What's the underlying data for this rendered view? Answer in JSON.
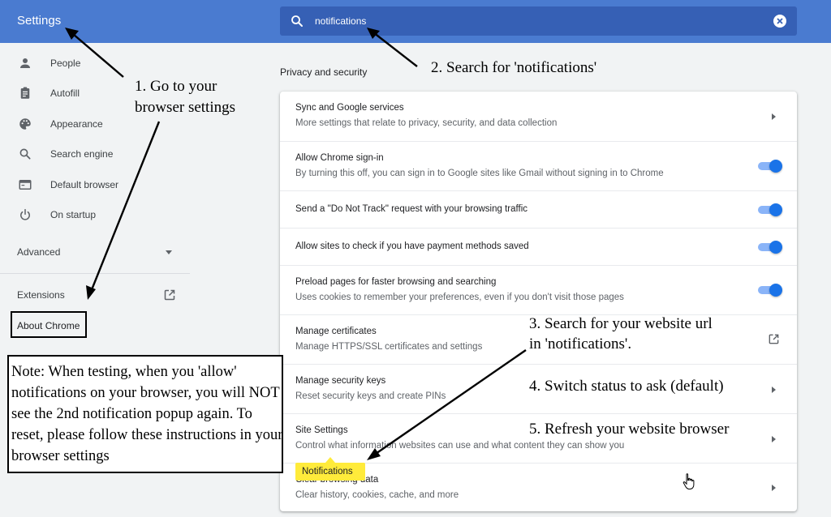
{
  "header": {
    "title": "Settings",
    "search_value": "notifications"
  },
  "sidebar": {
    "items": [
      {
        "label": "People",
        "icon": "person-icon"
      },
      {
        "label": "Autofill",
        "icon": "clipboard-icon"
      },
      {
        "label": "Appearance",
        "icon": "palette-icon"
      },
      {
        "label": "Search engine",
        "icon": "search-icon"
      },
      {
        "label": "Default browser",
        "icon": "browser-window-icon"
      },
      {
        "label": "On startup",
        "icon": "power-icon"
      }
    ],
    "advanced": "Advanced",
    "extensions": "Extensions",
    "about": "About Chrome"
  },
  "main": {
    "section_title": "Privacy and security",
    "rows": [
      {
        "title": "Sync and Google services",
        "subtitle": "More settings that relate to privacy, security, and data collection",
        "control": "arrow"
      },
      {
        "title": "Allow Chrome sign-in",
        "subtitle": "By turning this off, you can sign in to Google sites like Gmail without signing in to Chrome",
        "control": "toggle",
        "on": true
      },
      {
        "title": "Send a \"Do Not Track\" request with your browsing traffic",
        "subtitle": "",
        "control": "toggle",
        "on": true
      },
      {
        "title": "Allow sites to check if you have payment methods saved",
        "subtitle": "",
        "control": "toggle",
        "on": true
      },
      {
        "title": "Preload pages for faster browsing and searching",
        "subtitle": "Uses cookies to remember your preferences, even if you don't visit those pages",
        "control": "toggle",
        "on": true
      },
      {
        "title": "Manage certificates",
        "subtitle": "Manage HTTPS/SSL certificates and settings",
        "control": "external"
      },
      {
        "title": "Manage security keys",
        "subtitle": "Reset security keys and create PINs",
        "control": "arrow"
      },
      {
        "title": "Site Settings",
        "subtitle": "Control what information websites can use and what content they can show you",
        "control": "arrow"
      },
      {
        "title": "Clear browsing data",
        "subtitle": "Clear history, cookies, cache, and more",
        "control": "arrow"
      }
    ],
    "highlight_label": "Notifications"
  },
  "annotations": {
    "step1_line1": "1. Go to your",
    "step1_line2": "browser settings",
    "step2": "2. Search for 'notifications'",
    "step3_line1": "3. Search for your website url",
    "step3_line2": "in 'notifications'.",
    "step4": "4. Switch status to ask (default)",
    "step5": "5. Refresh your website browser",
    "note": "Note: When testing, when you 'allow' notifications on your browser, you will NOT see the 2nd notification popup again. To reset, please follow these instructions in your browser settings"
  },
  "colors": {
    "header": "#4a7bd0",
    "search": "#3660b5",
    "accent": "#1a73e8",
    "highlight": "#ffeb3b"
  }
}
